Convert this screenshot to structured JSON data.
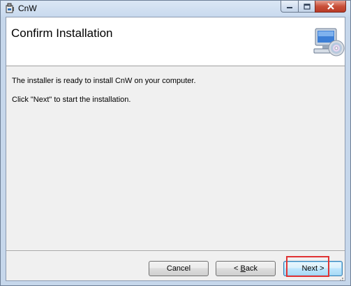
{
  "window": {
    "title": "CnW"
  },
  "header": {
    "title": "Confirm Installation",
    "icon": "computer-cd-icon"
  },
  "body": {
    "line1": "The installer is ready to install CnW on your computer.",
    "line2": "Click \"Next\" to start the installation."
  },
  "buttons": {
    "cancel": "Cancel",
    "back_mnemonic": "B",
    "back_rest": "ack",
    "back_prefix": "<",
    "next_label": "Next",
    "next_suffix": ">"
  },
  "titlebar_buttons": {
    "minimize": "minimize-icon",
    "maximize": "maximize-icon",
    "close": "close-icon"
  },
  "colors": {
    "highlight": "#e03333",
    "titlebar": "#c8d9ee",
    "close": "#c9503a"
  }
}
